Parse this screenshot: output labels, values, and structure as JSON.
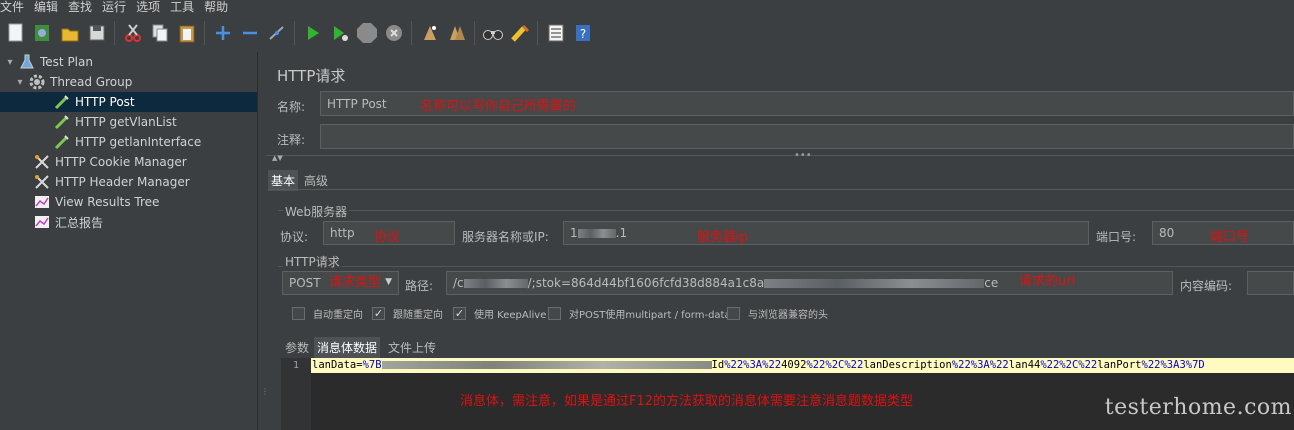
{
  "menubar": {
    "items": [
      "文件",
      "编辑",
      "查找",
      "运行",
      "选项",
      "工具",
      "帮助"
    ]
  },
  "toolbar": {
    "buttons": [
      "new-icon",
      "templates-icon",
      "open-icon",
      "save-icon",
      "cut-icon",
      "copy-icon",
      "paste-icon",
      "expand-icon",
      "collapse-icon",
      "toggle-icon",
      "start-icon",
      "start-no-pauses-icon",
      "stop-icon",
      "shutdown-icon",
      "clear-icon",
      "clear-all-icon",
      "search-icon",
      "reset-search-icon",
      "function-helper-icon",
      "help-icon"
    ]
  },
  "tree": {
    "items": [
      {
        "label": "Test Plan",
        "level": 0
      },
      {
        "label": "Thread Group",
        "level": 1
      },
      {
        "label": "HTTP Post",
        "level": 2,
        "selected": true
      },
      {
        "label": "HTTP getVlanList",
        "level": 2
      },
      {
        "label": "HTTP getlanInterface",
        "level": 2
      },
      {
        "label": "HTTP Cookie Manager",
        "level": 1
      },
      {
        "label": "HTTP Header Manager",
        "level": 1
      },
      {
        "label": "View Results Tree",
        "level": 1
      },
      {
        "label": "汇总报告",
        "level": 1
      }
    ]
  },
  "panel": {
    "title": "HTTP请求",
    "name_label": "名称:",
    "name_value": "HTTP Post",
    "name_annotation": "名称可以写你自己所需要的",
    "comment_label": "注释:",
    "comment_value": "",
    "tabs": [
      "基本",
      "高级"
    ],
    "web_server_title": "Web服务器",
    "protocol_label": "协议:",
    "protocol_value": "http",
    "protocol_annotation": "协议",
    "server_label": "服务器名称或IP:",
    "server_value_prefix": "1",
    "server_value_suffix": ".1",
    "server_annotation": "服务器ip",
    "port_label": "端口号:",
    "port_value": "80",
    "port_annotation": "端口号",
    "http_request_title": "HTTP请求",
    "method_value": "POST",
    "method_annotation": "请求类型",
    "path_label": "路径:",
    "path_value_prefix": "/c",
    "path_value_mid": "/;stok=864d44bf1606fcfd38d884a1c8a",
    "path_value_suffix": "ce",
    "path_annotation": "请求的url",
    "encoding_label": "内容编码:",
    "encoding_value": "",
    "checkboxes": [
      {
        "label": "自动重定向",
        "checked": false
      },
      {
        "label": "跟随重定向",
        "checked": true
      },
      {
        "label": "使用 KeepAlive",
        "checked": true
      },
      {
        "label": "对POST使用multipart / form-data",
        "checked": false
      },
      {
        "label": "与浏览器兼容的头",
        "checked": false
      }
    ],
    "body_tabs": [
      "参数",
      "消息体数据",
      "文件上传"
    ],
    "editor": {
      "line_number": "1",
      "line_prefix": "lanData=",
      "line_hl1": "%7B",
      "line_mid": "Id",
      "line_hl2": "%22%3A%22",
      "line_v1": "4092",
      "line_hl3": "%22%2C%22",
      "line_k2": "lanDescription",
      "line_hl4": "%22%3A%22",
      "line_v2": "lan44",
      "line_hl5": "%22%2C%22",
      "line_k3": "lanPort",
      "line_hl6": "%22%3A3%7D"
    },
    "body_annotation": "消息体，需注意，如果是通过F12的方法获取的消息体需要注意消息题数据类型"
  },
  "watermark": "testerhome.com"
}
